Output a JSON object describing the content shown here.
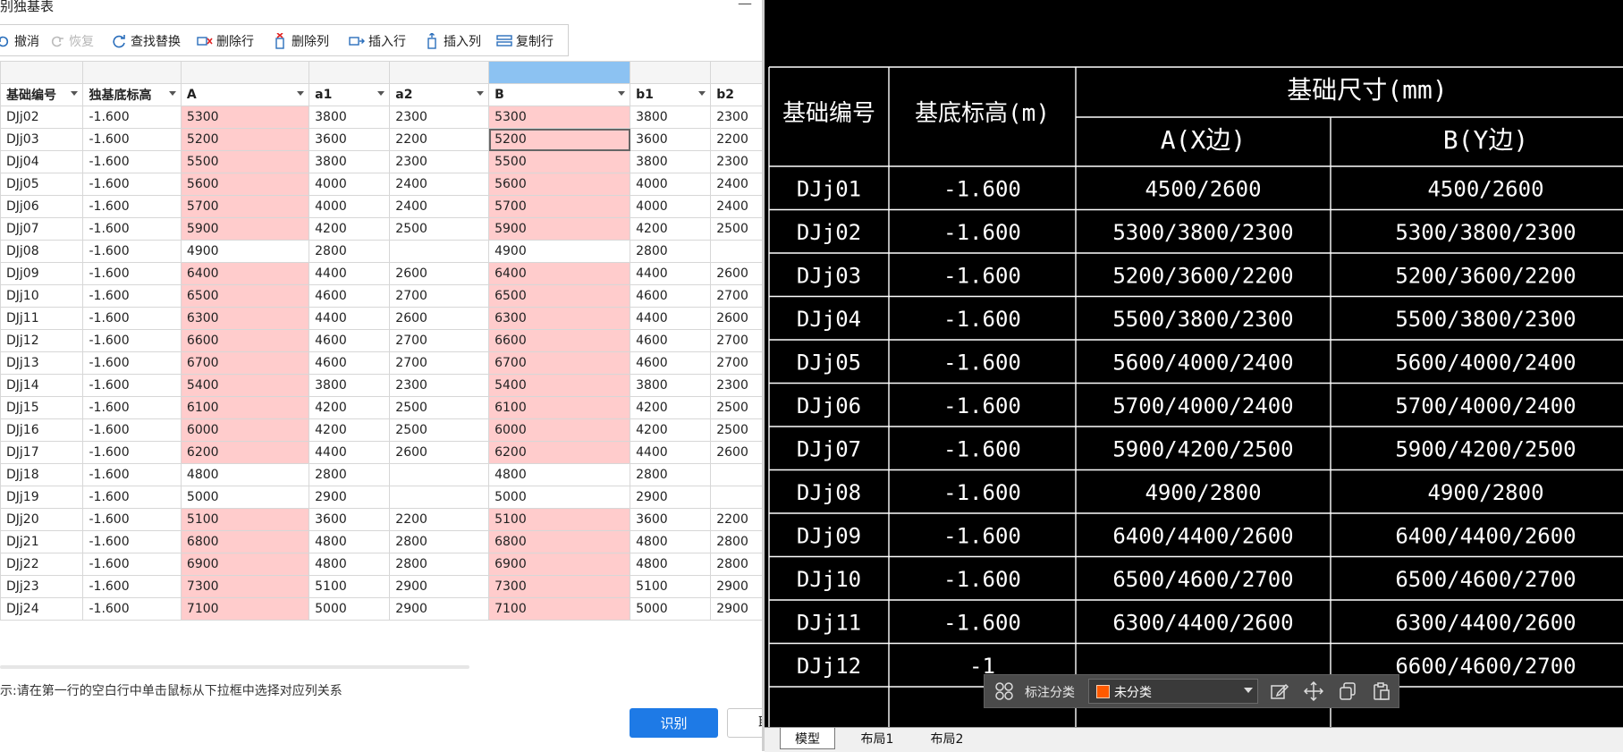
{
  "dialog": {
    "title": "别独基表",
    "minimize_glyph": "—",
    "toolbar": [
      {
        "label": "撤消",
        "icon": "undo-icon",
        "enabled": true
      },
      {
        "label": "恢复",
        "icon": "redo-icon",
        "enabled": false
      },
      {
        "label": "查找替换",
        "icon": "find-replace-icon",
        "enabled": true
      },
      {
        "label": "删除行",
        "icon": "delete-row-icon",
        "enabled": true
      },
      {
        "label": "删除列",
        "icon": "delete-column-icon",
        "enabled": true
      },
      {
        "label": "插入行",
        "icon": "insert-row-icon",
        "enabled": true
      },
      {
        "label": "插入列",
        "icon": "insert-column-icon",
        "enabled": true
      },
      {
        "label": "复制行",
        "icon": "copy-row-icon",
        "enabled": true
      }
    ],
    "selected_column": "B",
    "highlight_color": "#ffcccc",
    "selection_color": "#8cc2f2",
    "columns": [
      "基础编号",
      "独基底标高",
      "A",
      "a1",
      "a2",
      "B",
      "b1",
      "b2"
    ],
    "rows": [
      {
        "id": "DJj02",
        "elev": "-1.600",
        "A": "5300",
        "a1": "3800",
        "a2": "2300",
        "B": "5300",
        "b1": "3800",
        "b2": "2300",
        "hl": true
      },
      {
        "id": "DJj03",
        "elev": "-1.600",
        "A": "5200",
        "a1": "3600",
        "a2": "2200",
        "B": "5200",
        "b1": "3600",
        "b2": "2200",
        "hl": true
      },
      {
        "id": "DJj04",
        "elev": "-1.600",
        "A": "5500",
        "a1": "3800",
        "a2": "2300",
        "B": "5500",
        "b1": "3800",
        "b2": "2300",
        "hl": true
      },
      {
        "id": "DJj05",
        "elev": "-1.600",
        "A": "5600",
        "a1": "4000",
        "a2": "2400",
        "B": "5600",
        "b1": "4000",
        "b2": "2400",
        "hl": true
      },
      {
        "id": "DJj06",
        "elev": "-1.600",
        "A": "5700",
        "a1": "4000",
        "a2": "2400",
        "B": "5700",
        "b1": "4000",
        "b2": "2400",
        "hl": true
      },
      {
        "id": "DJj07",
        "elev": "-1.600",
        "A": "5900",
        "a1": "4200",
        "a2": "2500",
        "B": "5900",
        "b1": "4200",
        "b2": "2500",
        "hl": true
      },
      {
        "id": "DJj08",
        "elev": "-1.600",
        "A": "4900",
        "a1": "2800",
        "a2": "",
        "B": "4900",
        "b1": "2800",
        "b2": "",
        "hl": false
      },
      {
        "id": "DJj09",
        "elev": "-1.600",
        "A": "6400",
        "a1": "4400",
        "a2": "2600",
        "B": "6400",
        "b1": "4400",
        "b2": "2600",
        "hl": true
      },
      {
        "id": "DJj10",
        "elev": "-1.600",
        "A": "6500",
        "a1": "4600",
        "a2": "2700",
        "B": "6500",
        "b1": "4600",
        "b2": "2700",
        "hl": true
      },
      {
        "id": "DJj11",
        "elev": "-1.600",
        "A": "6300",
        "a1": "4400",
        "a2": "2600",
        "B": "6300",
        "b1": "4400",
        "b2": "2600",
        "hl": true
      },
      {
        "id": "DJj12",
        "elev": "-1.600",
        "A": "6600",
        "a1": "4600",
        "a2": "2700",
        "B": "6600",
        "b1": "4600",
        "b2": "2700",
        "hl": true
      },
      {
        "id": "DJj13",
        "elev": "-1.600",
        "A": "6700",
        "a1": "4600",
        "a2": "2700",
        "B": "6700",
        "b1": "4600",
        "b2": "2700",
        "hl": true
      },
      {
        "id": "DJj14",
        "elev": "-1.600",
        "A": "5400",
        "a1": "3800",
        "a2": "2300",
        "B": "5400",
        "b1": "3800",
        "b2": "2300",
        "hl": true
      },
      {
        "id": "DJj15",
        "elev": "-1.600",
        "A": "6100",
        "a1": "4200",
        "a2": "2500",
        "B": "6100",
        "b1": "4200",
        "b2": "2500",
        "hl": true
      },
      {
        "id": "DJj16",
        "elev": "-1.600",
        "A": "6000",
        "a1": "4200",
        "a2": "2500",
        "B": "6000",
        "b1": "4200",
        "b2": "2500",
        "hl": true
      },
      {
        "id": "DJj17",
        "elev": "-1.600",
        "A": "6200",
        "a1": "4400",
        "a2": "2600",
        "B": "6200",
        "b1": "4400",
        "b2": "2600",
        "hl": true
      },
      {
        "id": "DJj18",
        "elev": "-1.600",
        "A": "4800",
        "a1": "2800",
        "a2": "",
        "B": "4800",
        "b1": "2800",
        "b2": "",
        "hl": false
      },
      {
        "id": "DJj19",
        "elev": "-1.600",
        "A": "5000",
        "a1": "2900",
        "a2": "",
        "B": "5000",
        "b1": "2900",
        "b2": "",
        "hl": false
      },
      {
        "id": "DJj20",
        "elev": "-1.600",
        "A": "5100",
        "a1": "3600",
        "a2": "2200",
        "B": "5100",
        "b1": "3600",
        "b2": "2200",
        "hl": true
      },
      {
        "id": "DJj21",
        "elev": "-1.600",
        "A": "6800",
        "a1": "4800",
        "a2": "2800",
        "B": "6800",
        "b1": "4800",
        "b2": "2800",
        "hl": true
      },
      {
        "id": "DJj22",
        "elev": "-1.600",
        "A": "6900",
        "a1": "4800",
        "a2": "2800",
        "B": "6900",
        "b1": "4800",
        "b2": "2800",
        "hl": true
      },
      {
        "id": "DJj23",
        "elev": "-1.600",
        "A": "7300",
        "a1": "5100",
        "a2": "2900",
        "B": "7300",
        "b1": "5100",
        "b2": "2900",
        "hl": true
      },
      {
        "id": "DJj24",
        "elev": "-1.600",
        "A": "7100",
        "a1": "5000",
        "a2": "2900",
        "B": "7100",
        "b1": "5000",
        "b2": "2900",
        "hl": true
      }
    ],
    "hint": "示:请在第一行的空白行中单击鼠标从下拉框中选择对应列关系",
    "recognize_button": "识别",
    "cancel_button": "取消"
  },
  "cad": {
    "header": {
      "id": "基础编号",
      "elev": "基底标高(m)",
      "dim_group": "基础尺寸(mm)",
      "dim_a": "A(X边)",
      "dim_b": "B(Y边)"
    },
    "rows": [
      {
        "id": "DJj01",
        "elev": "-1.600",
        "a": "4500/2600",
        "b": "4500/2600"
      },
      {
        "id": "DJj02",
        "elev": "-1.600",
        "a": "5300/3800/2300",
        "b": "5300/3800/2300"
      },
      {
        "id": "DJj03",
        "elev": "-1.600",
        "a": "5200/3600/2200",
        "b": "5200/3600/2200"
      },
      {
        "id": "DJj04",
        "elev": "-1.600",
        "a": "5500/3800/2300",
        "b": "5500/3800/2300"
      },
      {
        "id": "DJj05",
        "elev": "-1.600",
        "a": "5600/4000/2400",
        "b": "5600/4000/2400"
      },
      {
        "id": "DJj06",
        "elev": "-1.600",
        "a": "5700/4000/2400",
        "b": "5700/4000/2400"
      },
      {
        "id": "DJj07",
        "elev": "-1.600",
        "a": "5900/4200/2500",
        "b": "5900/4200/2500"
      },
      {
        "id": "DJj08",
        "elev": "-1.600",
        "a": "4900/2800",
        "b": "4900/2800"
      },
      {
        "id": "DJj09",
        "elev": "-1.600",
        "a": "6400/4400/2600",
        "b": "6400/4400/2600"
      },
      {
        "id": "DJj10",
        "elev": "-1.600",
        "a": "6500/4600/2700",
        "b": "6500/4600/2700"
      },
      {
        "id": "DJj11",
        "elev": "-1.600",
        "a": "6300/4400/2600",
        "b": "6300/4400/2600"
      },
      {
        "id": "DJj12",
        "elev": "-1",
        "a": "",
        "b": "6600/4600/2700"
      }
    ],
    "annotation_toolbar": {
      "label": "标注分类",
      "select_value": "未分类",
      "swatch_color": "#ff5a00",
      "icons": [
        "grid-icon",
        "edit-icon",
        "move-icon",
        "copy-icon",
        "paste-icon"
      ]
    },
    "tabs": [
      "模型",
      "布局1",
      "布局2"
    ],
    "active_tab": "模型"
  }
}
